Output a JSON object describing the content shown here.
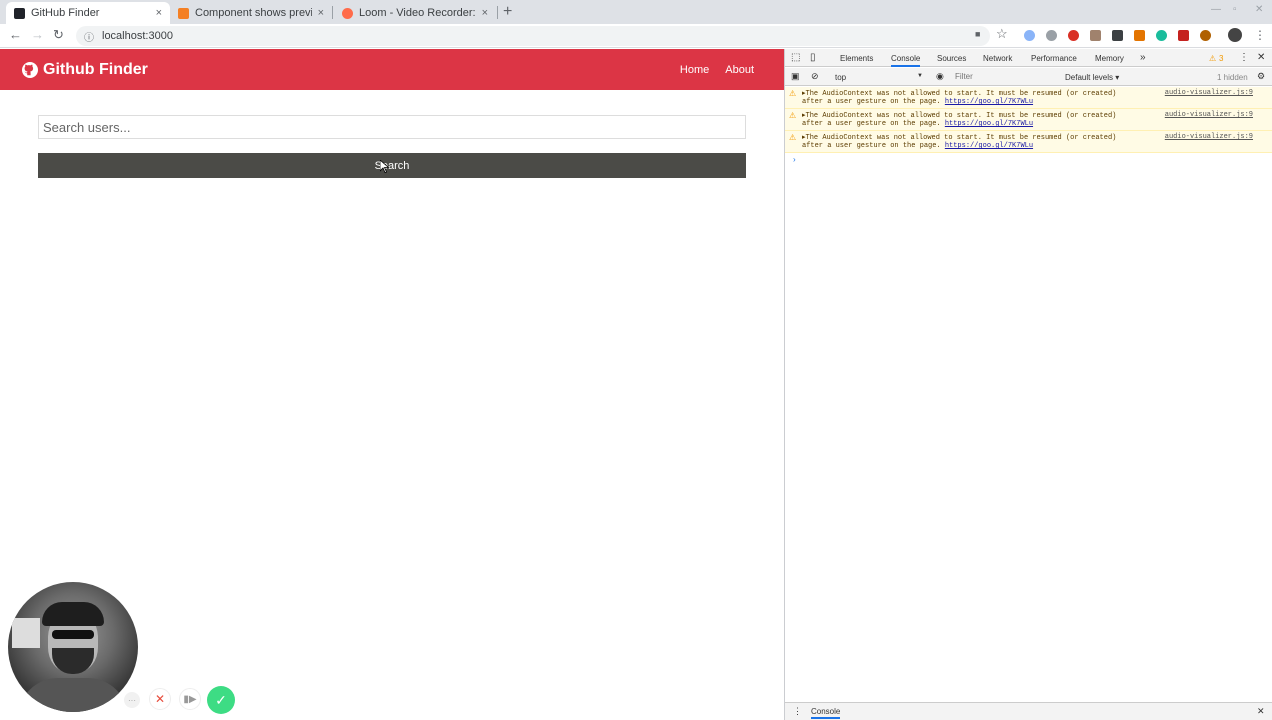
{
  "browser": {
    "tabs": [
      {
        "title": "GitHub Finder",
        "active": true
      },
      {
        "title": "Component shows previo",
        "active": false
      },
      {
        "title": "Loom - Video Recorder: Sc",
        "active": false
      }
    ],
    "tab_close": "×",
    "new_tab": "+",
    "url": "localhost:3000"
  },
  "app": {
    "brand": "Github Finder",
    "nav": {
      "home": "Home",
      "about": "About"
    },
    "search": {
      "placeholder": "Search users...",
      "button_label": "Search"
    },
    "navbar_color": "#dc3545"
  },
  "devtools": {
    "tabs": [
      "Elements",
      "Console",
      "Sources",
      "Network",
      "Performance",
      "Memory"
    ],
    "active_tab": "Console",
    "more": "»",
    "warning_count": "3",
    "context": "top",
    "filter_placeholder": "Filter",
    "levels": "Default levels ▾",
    "hidden": "1 hidden",
    "messages": [
      {
        "line1": "▸The AudioContext was not allowed to start. It must be resumed (or created)",
        "line2": "after a user gesture on the page.",
        "link": "https://goo.gl/7K7WLu",
        "source": "audio-visualizer.js:9"
      },
      {
        "line1": "▸The AudioContext was not allowed to start. It must be resumed (or created)",
        "line2": "after a user gesture on the page.",
        "link": "https://goo.gl/7K7WLu",
        "source": "audio-visualizer.js:9"
      },
      {
        "line1": "▸The AudioContext was not allowed to start. It must be resumed (or created)",
        "line2": "after a user gesture on the page.",
        "link": "https://goo.gl/7K7WLu",
        "source": "audio-visualizer.js:9"
      }
    ],
    "prompt": "›",
    "drawer_tab": "Console"
  },
  "loom": {
    "more": "···"
  }
}
